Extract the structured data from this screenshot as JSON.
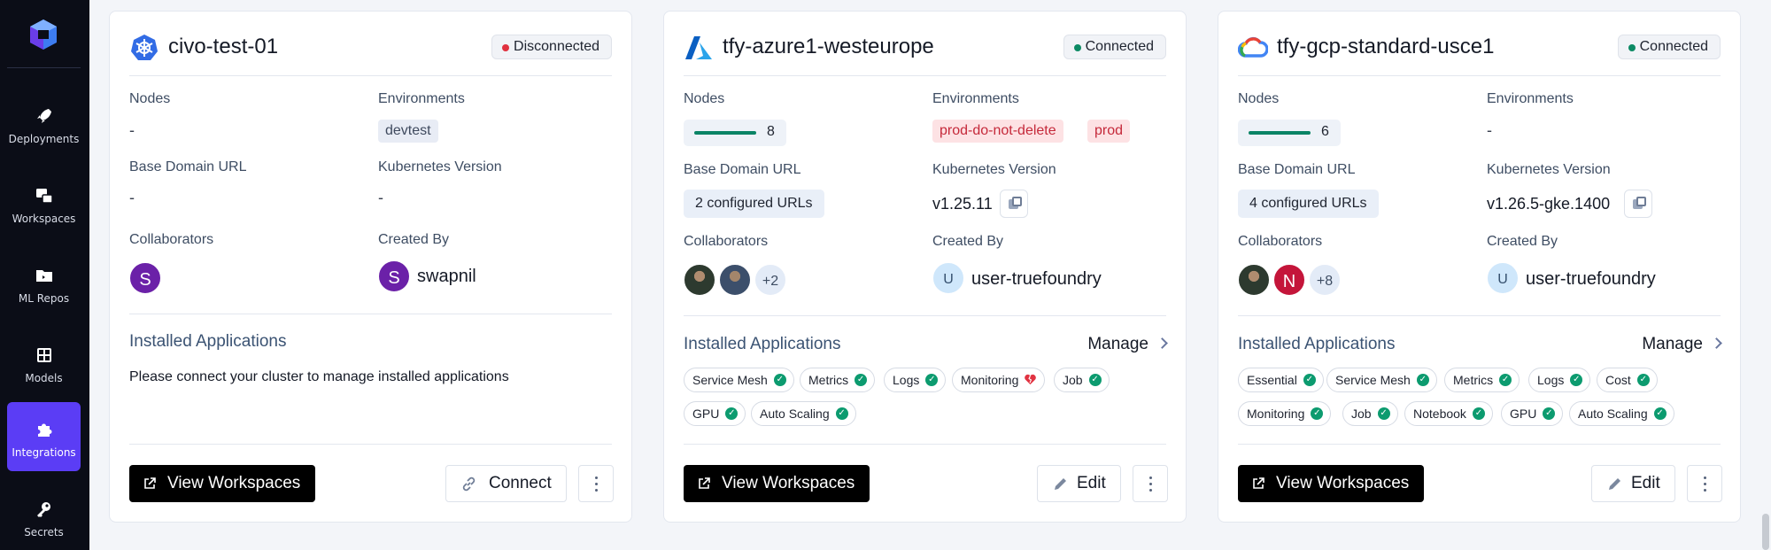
{
  "sidebar": {
    "logo": "truefoundry-logo-icon",
    "items": [
      {
        "label": "Deployments",
        "icon": "rocket-icon"
      },
      {
        "label": "Workspaces",
        "icon": "workspaces-icon"
      },
      {
        "label": "ML Repos",
        "icon": "folder-icon"
      },
      {
        "label": "Models",
        "icon": "grid-icon"
      },
      {
        "label": "Integrations",
        "icon": "puzzle-icon",
        "active": true
      },
      {
        "label": "Secrets",
        "icon": "key-icon"
      }
    ],
    "active_color": "#5b3df5"
  },
  "clusters": [
    {
      "name": "civo-test-01",
      "provider_icon": "kubernetes-icon",
      "status": "Disconnected",
      "status_color": "#e0313f",
      "labels": {
        "nodes": "Nodes",
        "environments": "Environments",
        "base_domain": "Base Domain URL",
        "k8s_version": "Kubernetes Version",
        "collaborators": "Collaborators",
        "created_by": "Created By",
        "installed": "Installed Applications"
      },
      "nodes_value": "-",
      "environments": [
        "devtest"
      ],
      "base_domain_value": "-",
      "k8s_version_value": "-",
      "collaborators": [
        "S"
      ],
      "created_by": {
        "initial": "S",
        "name": "swapnil"
      },
      "installed_note": "Please connect your cluster to manage installed applications",
      "primary_button": "View Workspaces",
      "secondary_button": "Connect"
    },
    {
      "name": "tfy-azure1-westeurope",
      "provider_icon": "azure-icon",
      "status": "Connected",
      "status_color": "#0c8a64",
      "labels": {
        "nodes": "Nodes",
        "environments": "Environments",
        "base_domain": "Base Domain URL",
        "k8s_version": "Kubernetes Version",
        "collaborators": "Collaborators",
        "created_by": "Created By",
        "installed": "Installed Applications",
        "manage": "Manage"
      },
      "nodes_count": "8",
      "environments": [
        "prod-do-not-delete",
        "prod"
      ],
      "base_domain_value": "2 configured URLs",
      "k8s_version_value": "v1.25.11",
      "collaborators_more": "+2",
      "created_by": {
        "initial": "U",
        "name": "user-truefoundry"
      },
      "apps_row1": [
        {
          "name": "Service Mesh",
          "state": "ok"
        },
        {
          "name": "Metrics",
          "state": "ok"
        },
        {
          "name": "Logs",
          "state": "ok"
        },
        {
          "name": "Monitoring",
          "state": "broken"
        },
        {
          "name": "Job",
          "state": "ok"
        }
      ],
      "apps_row2": [
        {
          "name": "GPU",
          "state": "ok"
        },
        {
          "name": "Auto Scaling",
          "state": "ok"
        }
      ],
      "primary_button": "View Workspaces",
      "secondary_button": "Edit"
    },
    {
      "name": "tfy-gcp-standard-usce1",
      "provider_icon": "google-cloud-icon",
      "status": "Connected",
      "status_color": "#0c8a64",
      "labels": {
        "nodes": "Nodes",
        "environments": "Environments",
        "base_domain": "Base Domain URL",
        "k8s_version": "Kubernetes Version",
        "collaborators": "Collaborators",
        "created_by": "Created By",
        "installed": "Installed Applications",
        "manage": "Manage"
      },
      "nodes_count": "6",
      "environments_value": "-",
      "base_domain_value": "4 configured URLs",
      "k8s_version_value": "v1.26.5-gke.1400",
      "collaborators": [
        "N"
      ],
      "collaborators_more": "+8",
      "created_by": {
        "initial": "U",
        "name": "user-truefoundry"
      },
      "apps_row1": [
        {
          "name": "Essential",
          "state": "ok"
        },
        {
          "name": "Service Mesh",
          "state": "ok"
        },
        {
          "name": "Metrics",
          "state": "ok"
        },
        {
          "name": "Logs",
          "state": "ok"
        },
        {
          "name": "Cost",
          "state": "ok"
        }
      ],
      "apps_row2": [
        {
          "name": "Monitoring",
          "state": "ok"
        },
        {
          "name": "Job",
          "state": "ok"
        },
        {
          "name": "Notebook",
          "state": "ok"
        },
        {
          "name": "GPU",
          "state": "ok"
        },
        {
          "name": "Auto Scaling",
          "state": "ok"
        }
      ],
      "primary_button": "View Workspaces",
      "secondary_button": "Edit"
    }
  ]
}
